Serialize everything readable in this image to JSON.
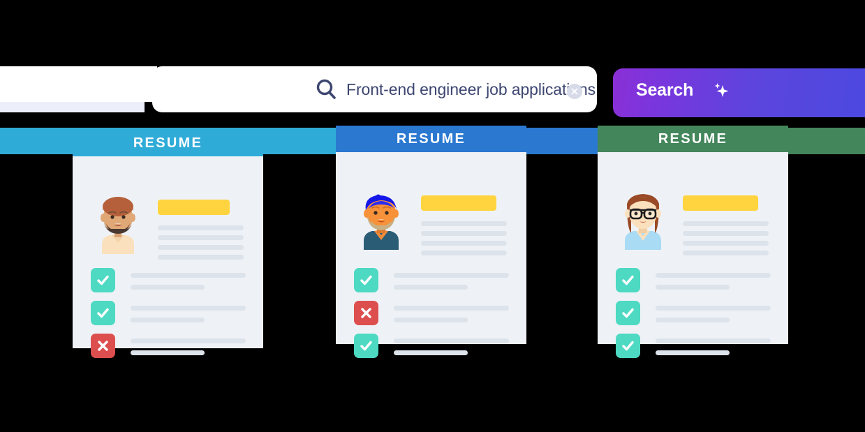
{
  "search": {
    "query": "Front-end engineer job applications",
    "placeholder": "Search",
    "search_icon": "magnifier-icon",
    "clear_icon": "clear-circle-icon",
    "button_label": "Search",
    "button_icon": "sparkle-icon",
    "button_gradient_from": "#8b2fd6",
    "button_gradient_to": "#4c49e0",
    "text_color": "#3d4670"
  },
  "bands": [
    {
      "color": "#2fabd8"
    },
    {
      "color": "#2a78d0"
    },
    {
      "color": "#44865b"
    }
  ],
  "cards": [
    {
      "header_title": "RESUME",
      "header_color": "#2fabd8",
      "avatar": "bearded-man-avatar",
      "name_bar_color": "#ffd43e",
      "info_lines": 4,
      "rows": [
        {
          "status": "check",
          "icon": "check-icon",
          "color": "#4ed9c3"
        },
        {
          "status": "check",
          "icon": "check-icon",
          "color": "#4ed9c3"
        },
        {
          "status": "cross",
          "icon": "cross-icon",
          "color": "#dd4f4f"
        }
      ]
    },
    {
      "header_title": "RESUME",
      "header_color": "#2a78d0",
      "avatar": "blue-hair-man-avatar",
      "name_bar_color": "#ffd43e",
      "info_lines": 4,
      "rows": [
        {
          "status": "check",
          "icon": "check-icon",
          "color": "#4ed9c3"
        },
        {
          "status": "cross",
          "icon": "cross-icon",
          "color": "#dd4f4f"
        },
        {
          "status": "check",
          "icon": "check-icon",
          "color": "#4ed9c3"
        }
      ]
    },
    {
      "header_title": "RESUME",
      "header_color": "#44865b",
      "avatar": "glasses-woman-avatar",
      "name_bar_color": "#ffd43e",
      "info_lines": 4,
      "rows": [
        {
          "status": "check",
          "icon": "check-icon",
          "color": "#4ed9c3"
        },
        {
          "status": "check",
          "icon": "check-icon",
          "color": "#4ed9c3"
        },
        {
          "status": "check",
          "icon": "check-icon",
          "color": "#4ed9c3"
        }
      ]
    }
  ]
}
